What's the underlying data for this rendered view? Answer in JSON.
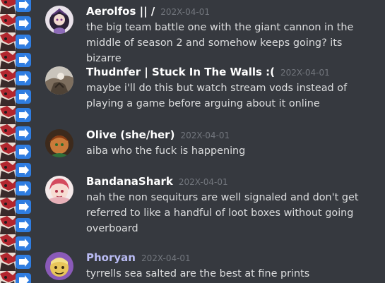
{
  "messages": [
    {
      "username": "Aerolfos || /",
      "timestamp": "202X-04-01",
      "text": "the big team battle one with the giant cannon in the middle of season 2 and somehow keeps going? its bizarre",
      "avatar_icon": "avatar-aerolfos"
    },
    {
      "username": "Thudnfer | Stuck In The Walls :(",
      "timestamp": "202X-04-01",
      "text": "maybe i'll do this but watch stream vods instead of playing a game before arguing about it online",
      "avatar_icon": "avatar-thudnfer"
    },
    {
      "username": "Olive (she/her)",
      "timestamp": "202X-04-01",
      "text": "aiba who the fuck is happening",
      "avatar_icon": "avatar-olive"
    },
    {
      "username": "BandanaShark",
      "timestamp": "202X-04-01",
      "text": "nah the non sequiturs are well signaled and don't get referred to like a handful of loot boxes without going overboard",
      "avatar_icon": "avatar-bandanashark"
    },
    {
      "username": "Phoryan",
      "timestamp": "202X-04-01",
      "text": "tyrrells sea salted are the best at fine prints",
      "avatar_icon": "avatar-phoryan"
    }
  ],
  "colors": {
    "background": "#36393f",
    "username_default": "#ffffff",
    "username_role": "#b9bbf3",
    "timestamp": "#72767d",
    "message_text": "#dcddde"
  }
}
